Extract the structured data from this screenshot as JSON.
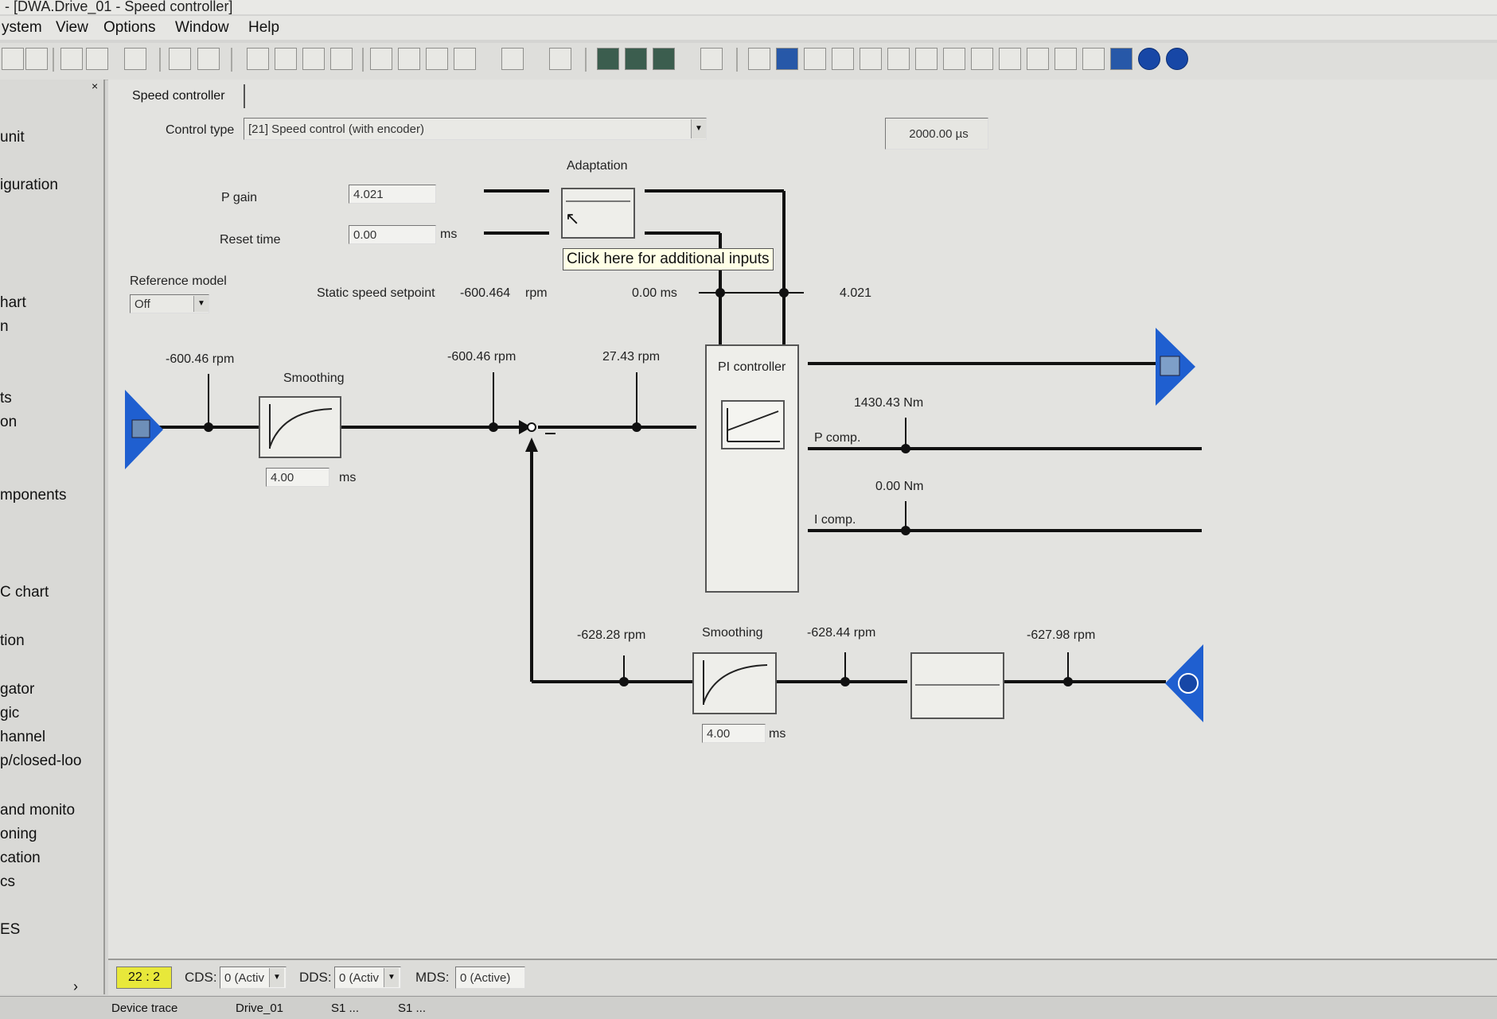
{
  "window": {
    "title": "- [DWA.Drive_01 - Speed controller]"
  },
  "menu": {
    "items": [
      "ystem",
      "View",
      "Options",
      "Window",
      "Help"
    ]
  },
  "tree": {
    "items": [
      "unit",
      "iguration",
      "hart",
      "n",
      "ts",
      "on",
      "mponents",
      "C chart",
      "tion",
      "gator",
      "gic",
      "hannel",
      "p/closed-loo",
      "and monito",
      "oning",
      "cation",
      "cs",
      "ES"
    ]
  },
  "panel": {
    "tab_label": "Speed controller",
    "control_type_label": "Control type",
    "control_type_value": "[21] Speed control (with encoder)",
    "sample_time": "2000.00 µs",
    "adaptation_label": "Adaptation",
    "tooltip": "Click here for additional inputs",
    "p_gain_label": "P gain",
    "p_gain_value": "4.021",
    "reset_time_label": "Reset time",
    "reset_time_value": "0.00",
    "reset_time_unit": "ms",
    "reference_model_label": "Reference model",
    "reference_model_value": "Off",
    "static_setpoint_label": "Static speed setpoint",
    "static_setpoint_value": "-600.464",
    "static_setpoint_unit": "rpm",
    "reset_time_readout": "0.00 ms",
    "p_gain_readout": "4.021"
  },
  "diagram": {
    "setpoint_in": "-600.46 rpm",
    "smoothing1_label": "Smoothing",
    "smoothing1_time": "4.00",
    "smoothing1_unit": "ms",
    "after_smoothing": "-600.46 rpm",
    "error": "27.43 rpm",
    "pi_label": "PI controller",
    "torque_total": "1430.43 Nm",
    "p_comp_label": "P comp.",
    "i_comp_value": "0.00 Nm",
    "i_comp_label": "I comp.",
    "feedback_filtered": "-628.28 rpm",
    "smoothing2_label": "Smoothing",
    "smoothing2_time": "4.00",
    "smoothing2_unit": "ms",
    "feedback_mid": "-628.44 rpm",
    "feedback_raw": "-627.98 rpm"
  },
  "status": {
    "indicator": "22 : 2",
    "cds_label": "CDS:",
    "cds_value": "0 (Activ",
    "dds_label": "DDS:",
    "dds_value": "0 (Activ",
    "mds_label": "MDS:",
    "mds_value": "0 (Active)"
  },
  "taskbar": {
    "items": [
      "Device trace",
      "Drive_01",
      "S1 ...",
      "S1 ..."
    ]
  },
  "colors": {
    "accent_blue": "#1f5fd0",
    "status_yellow": "#e8e83a"
  }
}
